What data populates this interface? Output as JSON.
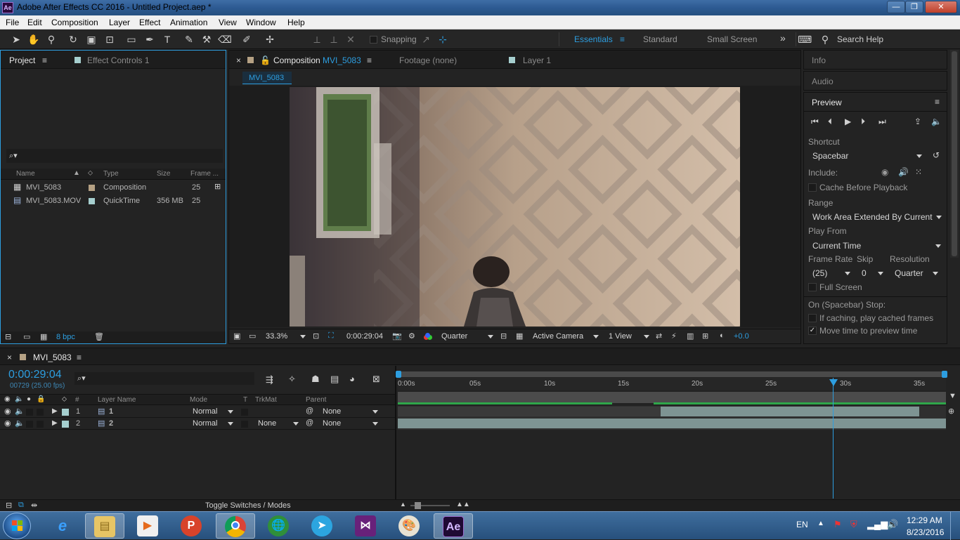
{
  "window": {
    "app_icon": "Ae",
    "title": "Adobe After Effects CC 2016 - Untitled Project.aep *",
    "controls": {
      "minimize": "—",
      "maximize": "❐",
      "close": "✕"
    }
  },
  "menu": [
    "File",
    "Edit",
    "Composition",
    "Layer",
    "Effect",
    "Animation",
    "View",
    "Window",
    "Help"
  ],
  "toolbar": {
    "snapping_label": "Snapping",
    "workspaces": [
      "Essentials",
      "Standard",
      "Small Screen"
    ],
    "active_workspace": "Essentials",
    "more": "»",
    "search_placeholder": "Search Help"
  },
  "project_panel": {
    "tabs": [
      "Project",
      "Effect Controls 1"
    ],
    "search_icon": "⌕▾",
    "columns": [
      "Name",
      "Type",
      "Size",
      "Frame ..."
    ],
    "items": [
      {
        "name": "MVI_5083",
        "type": "Composition",
        "size": "",
        "frame": "25",
        "color": "#b5a184"
      },
      {
        "name": "MVI_5083.MOV",
        "type": "QuickTime",
        "size": "356 MB",
        "frame": "25",
        "color": "#a6cfcf"
      }
    ],
    "bpc": "8 bpc"
  },
  "comp_panel": {
    "tabs": [
      {
        "prefix": "Composition",
        "name": "MVI_5083"
      },
      {
        "prefix": "Footage",
        "name": "(none)"
      },
      {
        "prefix": "Layer",
        "name": "1"
      }
    ],
    "close": "×",
    "subtab": "MVI_5083",
    "zoom": "33.3%",
    "timecode": "0:00:29:04",
    "resolution": "Quarter",
    "camera": "Active Camera",
    "views": "1 View",
    "exposure": "+0.0"
  },
  "right_panel": {
    "info_label": "Info",
    "audio_label": "Audio",
    "preview_label": "Preview",
    "shortcut_label": "Shortcut",
    "shortcut_value": "Spacebar",
    "include_label": "Include:",
    "cache_label": "Cache Before Playback",
    "range_label": "Range",
    "range_value": "Work Area Extended By Current Ti",
    "play_from_label": "Play From",
    "play_from_value": "Current Time",
    "frame_rate_label": "Frame Rate",
    "frame_rate_value": "(25)",
    "skip_label": "Skip",
    "skip_value": "0",
    "resolution_label": "Resolution",
    "resolution_value": "Quarter",
    "full_screen_label": "Full Screen",
    "stop_label": "On (Spacebar) Stop:",
    "if_caching_label": "If caching, play cached frames",
    "move_time_label": "Move time to preview time"
  },
  "timeline": {
    "tab_name": "MVI_5083",
    "current_time": "0:00:29:04",
    "frame_info": "00729 (25.00 fps)",
    "columns": {
      "hash": "#",
      "layer_name": "Layer Name",
      "mode": "Mode",
      "t": "T",
      "trkmat": "TrkMat",
      "parent": "Parent"
    },
    "layers": [
      {
        "index": "1",
        "name": "1",
        "mode": "Normal",
        "trkmat": "",
        "parent": "None",
        "color": "#a6cfcf"
      },
      {
        "index": "2",
        "name": "2",
        "mode": "Normal",
        "trkmat": "None",
        "parent": "None",
        "color": "#a6cfcf"
      }
    ],
    "ruler_labels": [
      "0:00s",
      "05s",
      "10s",
      "15s",
      "20s",
      "25s",
      "30s",
      "35s"
    ],
    "toggle_label": "Toggle Switches / Modes"
  },
  "taskbar": {
    "apps": [
      "ie-icon",
      "explorer-icon",
      "media-player-icon",
      "p-icon",
      "chrome-icon",
      "globe-icon",
      "telegram-icon",
      "visual-studio-icon",
      "paint-icon",
      "after-effects-icon"
    ],
    "language": "EN",
    "time": "12:29 AM",
    "date": "8/23/2016"
  },
  "colors": {
    "accent": "#2d9ee0",
    "panel": "#232323"
  }
}
